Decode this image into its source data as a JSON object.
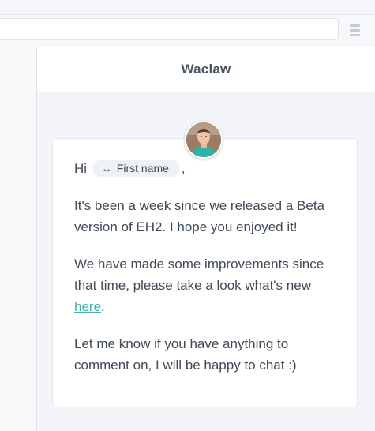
{
  "preview": {
    "sender_name": "Waclaw",
    "greeting": "Hi",
    "variable_chip": {
      "icon": "arrows-horizontal-icon",
      "label": "First name"
    },
    "greeting_suffix": ",",
    "paragraph_1": "It's been a week since we released a Beta version of EH2. I hope you enjoyed it!",
    "paragraph_2_before_link": "We have made some improvements since that time, please take a look what's new",
    "paragraph_2_link": "here",
    "paragraph_2_after_link": ".",
    "paragraph_3": "Let me know if you have anything to comment on, I will be happy to chat :)"
  },
  "colors": {
    "link": "#3fb3a3",
    "panel_background": "#f3f5f8",
    "card_background": "#ffffff"
  }
}
